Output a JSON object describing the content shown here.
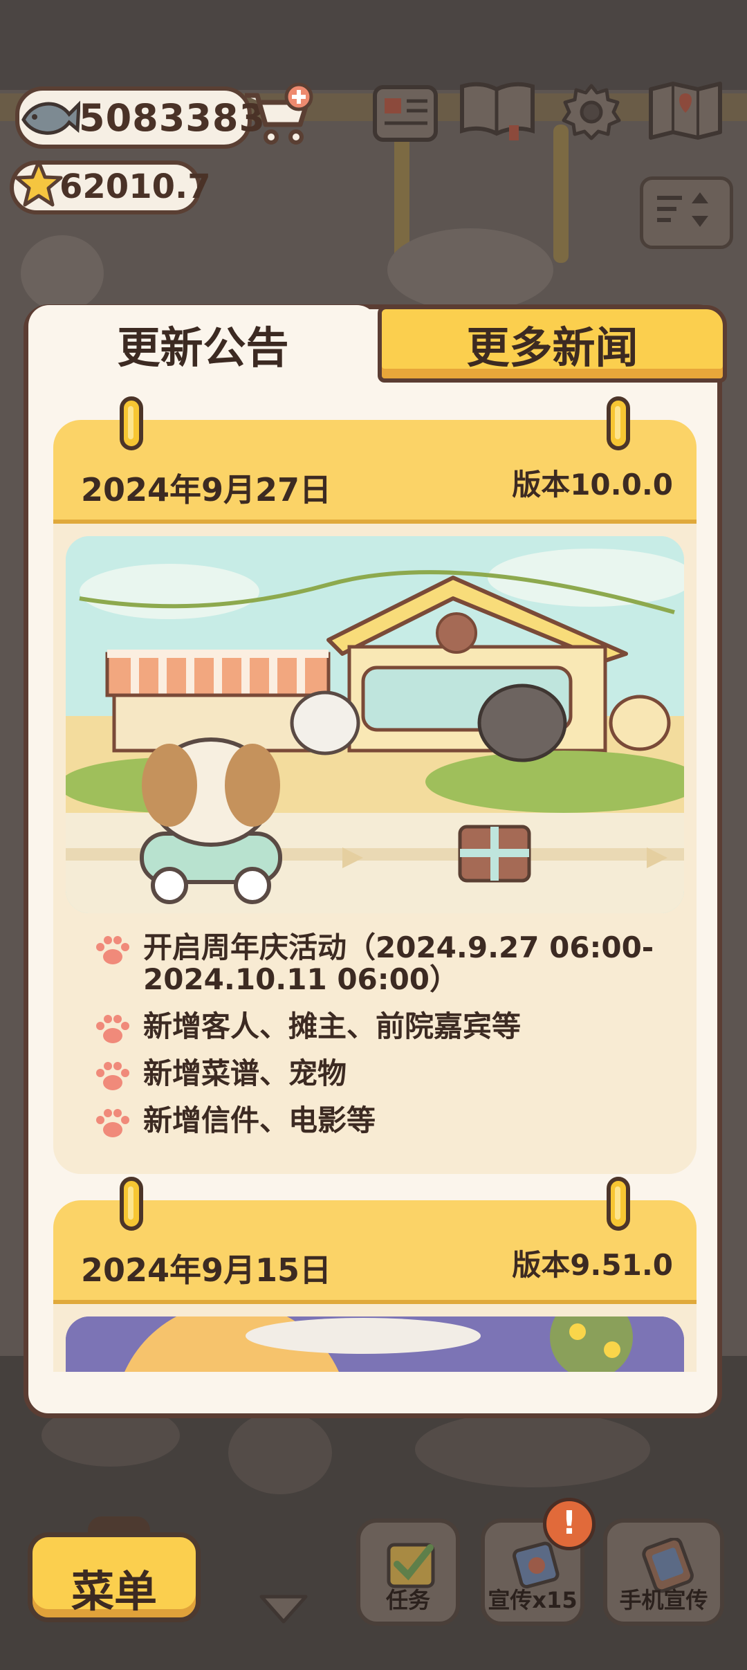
{
  "hud": {
    "fish_count": "5083383",
    "star_count": "62010.7"
  },
  "modal": {
    "tabs": [
      {
        "label": "更新公告"
      },
      {
        "label": "更多新闻"
      }
    ],
    "announcements": [
      {
        "date": "2024年9月27日",
        "version": "版本10.0.0",
        "bullets": [
          "开启周年庆活动（2024.9.27 06:00-2024.10.11 06:00）",
          "新增客人、摊主、前院嘉宾等",
          "新增菜谱、宠物",
          "新增信件、电影等"
        ]
      },
      {
        "date": "2024年9月15日",
        "version": "版本9.51.0"
      }
    ]
  },
  "bottom_bar": {
    "menu_label": "菜单",
    "tasks_label": "任务",
    "promote_label": "宣传x15",
    "phone_promote_label": "手机宣传",
    "alert_mark": "!"
  },
  "colors": {
    "accent_yellow": "#fbcf4e",
    "outline_brown": "#5b3d33",
    "panel_cream": "#fbf5ec",
    "card_bg": "#f8ebd3",
    "paw_pink": "#f08a7a"
  }
}
